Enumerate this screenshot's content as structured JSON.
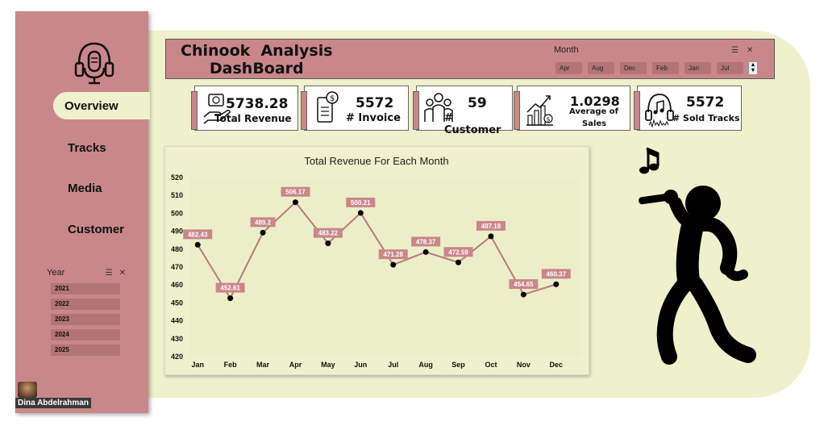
{
  "sidebar": {
    "nav": [
      {
        "label": "Overview",
        "active": true
      },
      {
        "label": "Tracks",
        "active": false
      },
      {
        "label": "Media",
        "active": false
      },
      {
        "label": "Customer",
        "active": false
      }
    ],
    "year_slicer": {
      "title": "Year",
      "items": [
        "2021",
        "2022",
        "2023",
        "2024",
        "2025"
      ]
    },
    "logo_icon": "podcast-headphones-icon"
  },
  "author": {
    "name": "Dina Abdelrahman"
  },
  "header": {
    "title_line1": "Chinook  Analysis",
    "title_line2": "DashBoard",
    "month_slicer": {
      "title": "Month",
      "items": [
        "Apr",
        "Aug",
        "Dec",
        "Feb",
        "Jan",
        "Jul"
      ]
    }
  },
  "cards": [
    {
      "value": "5738.28",
      "label": "Total Revenue",
      "icon": "money-hand-icon"
    },
    {
      "value": "5572",
      "label": "# Invoice",
      "icon": "invoice-icon"
    },
    {
      "value": "59",
      "label": "# Customer",
      "icon": "customers-icon"
    },
    {
      "value": "1.0298",
      "label_line1": "Average of",
      "label_line2": "Sales",
      "icon": "growth-chart-icon"
    },
    {
      "value": "5572",
      "label": "# Sold Tracks",
      "icon": "music-headphones-icon"
    }
  ],
  "colors": {
    "primary": "#c9878a",
    "background": "#eff0cc",
    "line": "#b77a7c",
    "label_bg": "#c9878a"
  },
  "chart_data": {
    "type": "line",
    "title": "Total Revenue For Each Month",
    "categories": [
      "Jan",
      "Feb",
      "Mar",
      "Apr",
      "May",
      "Jun",
      "Jul",
      "Aug",
      "Sep",
      "Oct",
      "Nov",
      "Dec"
    ],
    "values": [
      482.43,
      452.61,
      489.2,
      506.17,
      483.22,
      500.21,
      471.28,
      478.37,
      472.59,
      487.18,
      454.65,
      460.37
    ],
    "data_labels": [
      "482.43",
      "452.61",
      "489.2",
      "506.17",
      "483.22",
      "500.21",
      "471.28",
      "478.37",
      "472.59",
      "487.18",
      "454.65",
      "460.37"
    ],
    "yticks": [
      520,
      510,
      500,
      490,
      480,
      470,
      460,
      450,
      440,
      430,
      420
    ],
    "ylim": [
      420,
      520
    ],
    "grid": false,
    "legend": "none"
  }
}
